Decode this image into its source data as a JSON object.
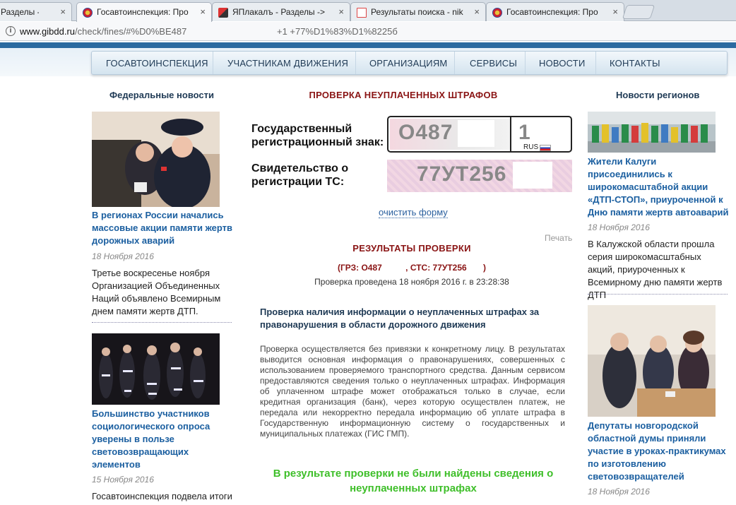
{
  "browser": {
    "tabs": [
      {
        "label": "Разделы ->",
        "active": false
      },
      {
        "label": "Госавтоинспекция: Про",
        "active": true
      },
      {
        "label": "ЯПлакалъ - Разделы ->",
        "active": false
      },
      {
        "label": "Результаты поиска - nik",
        "active": false
      },
      {
        "label": "Госавтоинспекция: Про",
        "active": false
      }
    ],
    "close_glyph": "×",
    "url_host": "www.gibdd.ru",
    "url_path": "/check/fines/#%D0%BE487",
    "url_tail": "+1     +77%D1%83%D1%8225б"
  },
  "nav": {
    "items": [
      "ГОСАВТОИНСПЕКЦИЯ",
      "УЧАСТНИКАМ ДВИЖЕНИЯ",
      "ОРГАНИЗАЦИЯМ",
      "СЕРВИСЫ",
      "НОВОСТИ",
      "КОНТАКТЫ"
    ]
  },
  "left": {
    "title": "Федеральные новости",
    "news": [
      {
        "link": "В регионах России начались массовые акции памяти жертв дорожных аварий",
        "date": "18 Ноября 2016",
        "text": "Третье воскресенье ноября Организацией Объединенных Наций объявлено Всемирным днем памяти жертв ДТП."
      },
      {
        "link": "Большинство участников социологического опроса уверены в пользе световозвращающих элементов",
        "date": "15 Ноября 2016",
        "text": "Госавтоинспекция подвела итоги"
      }
    ]
  },
  "center": {
    "title": "ПРОВЕРКА НЕУПЛАЧЕННЫХ ШТРАФОВ",
    "plate_label": "Государственный регистрационный знак:",
    "plate_number": "О487",
    "plate_region": "1",
    "plate_country": "RUS",
    "sts_label": "Свидетельство о регистрации ТС:",
    "sts_number": "77УТ256",
    "clear_link": "очистить форму",
    "print_link": "Печать",
    "result_title": "РЕЗУЛЬТАТЫ ПРОВЕРКИ",
    "result_sub": "(ГРЗ: О487          , СТС: 77УТ256       )",
    "result_time": "Проверка проведена 18 ноября 2016 г. в 23:28:38",
    "result_heading": "Проверка наличия информации о неуплаченных штрафах за правонарушения в области дорожного движения",
    "result_body": "Проверка осуществляется без привязки к конкретному лицу. В результатах выводится основная информация о правонарушениях, совершенных с использованием проверяемого транспортного средства. Данным сервисом предоставляются сведения только о неуплаченных штрафах. Информация об уплаченном штрафе может отображаться только в случае, если кредитная организация (банк), через которую осуществлен платеж, не передала или некорректно передала информацию об уплате штрафа в Государственную информационную систему о государственных и муниципальных платежах (ГИС ГМП).",
    "result_ok": "В результате проверки не были найдены сведения о неуплаченных штрафах"
  },
  "right": {
    "title": "Новости регионов",
    "news": [
      {
        "link": "Жители Калуги присоединились к широкомасштабной акции «ДТП-СТОП», приуроченной к Дню памяти жертв автоаварий",
        "date": "18 Ноября 2016",
        "text": "В Калужской области прошла серия широкомасштабных акций, приуроченных к Всемирному дню памяти жертв ДТП"
      },
      {
        "link": "Депутаты новгородской областной думы приняли участие в уроках-практикумах по изготовлению световозвращателей",
        "date": "18 Ноября 2016",
        "text": ""
      }
    ]
  },
  "colors": {
    "accent_red": "#8a1414",
    "link_blue": "#1b5fa0",
    "success_green": "#3fbf2a",
    "header_blue": "#2b6aa0"
  }
}
